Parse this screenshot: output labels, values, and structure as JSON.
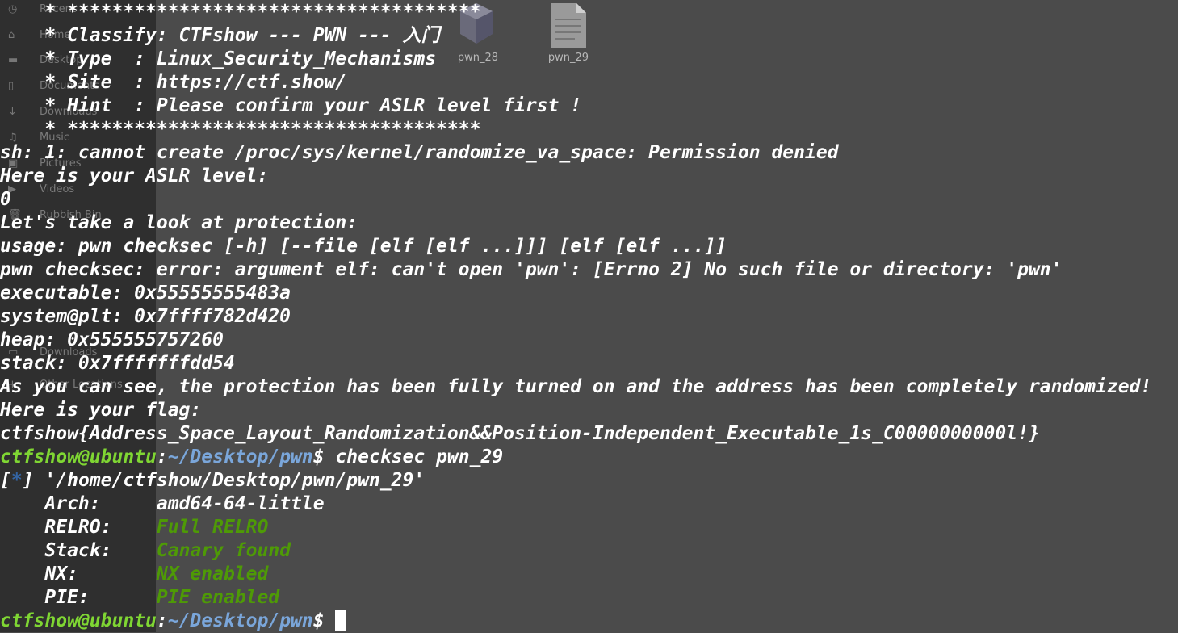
{
  "file_manager": {
    "sidebar_items": [
      {
        "icon": "clock-icon",
        "label": "Recent"
      },
      {
        "icon": "home-icon",
        "label": "Home"
      },
      {
        "icon": "desktop-icon",
        "label": "Desktop"
      },
      {
        "icon": "document-icon",
        "label": "Documents"
      },
      {
        "icon": "download-icon",
        "label": "Downloads"
      },
      {
        "icon": "music-icon",
        "label": "Music"
      },
      {
        "icon": "picture-icon",
        "label": "Pictures"
      },
      {
        "icon": "video-icon",
        "label": "Videos"
      },
      {
        "icon": "trash-icon",
        "label": "Rubbish Bin"
      },
      {
        "icon": "drive-icon",
        "label": "Downloads"
      },
      {
        "icon": "plus-icon",
        "label": "Other Locations"
      }
    ],
    "files": [
      {
        "name": "pwn_28",
        "icon": "executable-icon"
      },
      {
        "name": "pwn_29",
        "icon": "text-file-icon"
      }
    ]
  },
  "terminal": {
    "banner_border": "    * *************************************",
    "banner_classify": "    * Classify: CTFshow --- PWN --- 入门",
    "banner_type": "    * Type  : Linux_Security_Mechanisms",
    "banner_site": "    * Site  : https://ctf.show/",
    "banner_hint": "    * Hint  : Please confirm your ASLR level first !",
    "line_sh_error": "sh: 1: cannot create /proc/sys/kernel/randomize_va_space: Permission denied",
    "line_aslr_label": "Here is your ASLR level:",
    "line_aslr_value": "0",
    "line_protection": "Let's take a look at protection:",
    "line_usage": "usage: pwn checksec [-h] [--file [elf [elf ...]]] [elf [elf ...]]",
    "line_checksec_error": "pwn checksec: error: argument elf: can't open 'pwn': [Errno 2] No such file or directory: 'pwn'",
    "line_executable": "executable: 0x55555555483a",
    "line_system": "system@plt: 0x7ffff782d420",
    "line_heap": "heap: 0x555555757260",
    "line_stack": "stack: 0x7fffffffdd54",
    "line_randomized": "As you can see, the protection has been fully turned on and the address has been completely randomized!",
    "line_flag_label": "Here is your flag:",
    "line_flag": "ctfshow{Address_Space_Layout_Randomization&&Position-Independent_Executable_1s_C0000000000l!}",
    "prompt_user": "ctfshow@ubuntu",
    "prompt_colon": ":",
    "prompt_path": "~/Desktop/pwn",
    "prompt_dollar": "$ ",
    "command": "checksec pwn_29",
    "info_open": "[",
    "info_star": "*",
    "info_rest": "] '/home/ctfshow/Desktop/pwn/pwn_29'",
    "checks": [
      {
        "key": "    Arch:     ",
        "value": "amd64-64-little",
        "status": "neutral"
      },
      {
        "key": "    RELRO:    ",
        "value": "Full RELRO",
        "status": "good"
      },
      {
        "key": "    Stack:    ",
        "value": "Canary found",
        "status": "good"
      },
      {
        "key": "    NX:       ",
        "value": "NX enabled",
        "status": "good"
      },
      {
        "key": "    PIE:      ",
        "value": "PIE enabled",
        "status": "good"
      }
    ]
  },
  "colors": {
    "background": "#4b4b4b",
    "text": "#ffffff",
    "prompt_user": "#7fd633",
    "prompt_path": "#7aa6da",
    "status_good": "#4e9a06",
    "info_star": "#3465a4"
  }
}
